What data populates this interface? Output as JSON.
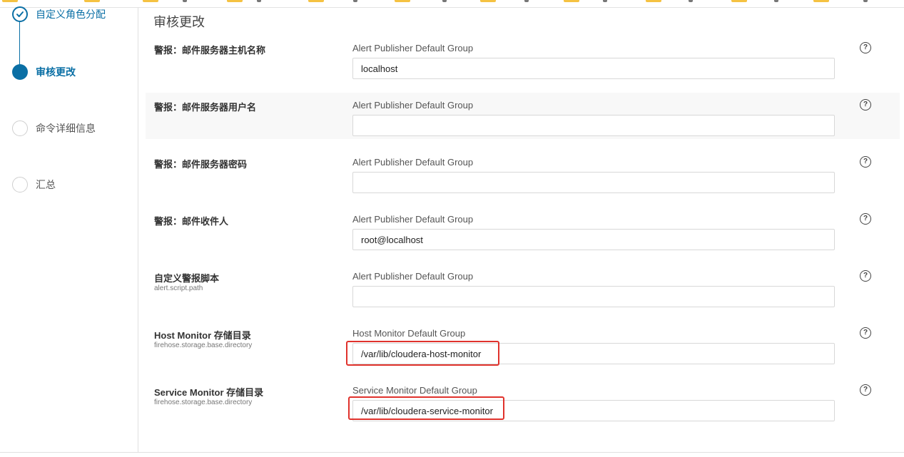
{
  "sidebar": {
    "steps": [
      {
        "label": "自定义角色分配",
        "state": "done"
      },
      {
        "label": "审核更改",
        "state": "active"
      },
      {
        "label": "命令详细信息",
        "state": "pending"
      },
      {
        "label": "汇总",
        "state": "pending"
      }
    ]
  },
  "main": {
    "title": "审核更改",
    "help_glyph": "?",
    "rows": [
      {
        "label": "警报：邮件服务器主机名称",
        "sublabel": "",
        "group": "Alert Publisher Default Group",
        "value": "localhost"
      },
      {
        "label": "警报：邮件服务器用户名",
        "sublabel": "",
        "group": "Alert Publisher Default Group",
        "value": ""
      },
      {
        "label": "警报：邮件服务器密码",
        "sublabel": "",
        "group": "Alert Publisher Default Group",
        "value": ""
      },
      {
        "label": "警报：邮件收件人",
        "sublabel": "",
        "group": "Alert Publisher Default Group",
        "value": "root@localhost"
      },
      {
        "label": "自定义警报脚本",
        "sublabel": "alert.script.path",
        "group": "Alert Publisher Default Group",
        "value": ""
      },
      {
        "label": "Host Monitor 存储目录",
        "sublabel": "firehose.storage.base.directory",
        "group": "Host Monitor Default Group",
        "value": "/var/lib/cloudera-host-monitor"
      },
      {
        "label": "Service Monitor 存储目录",
        "sublabel": "firehose.storage.base.directory",
        "group": "Service Monitor Default Group",
        "value": "/var/lib/cloudera-service-monitor"
      }
    ]
  },
  "colors": {
    "accent": "#0a6fa5",
    "highlight": "#e0322c",
    "row_shade": "#f8f8f8"
  },
  "icons": [
    "check-icon",
    "help-icon"
  ]
}
